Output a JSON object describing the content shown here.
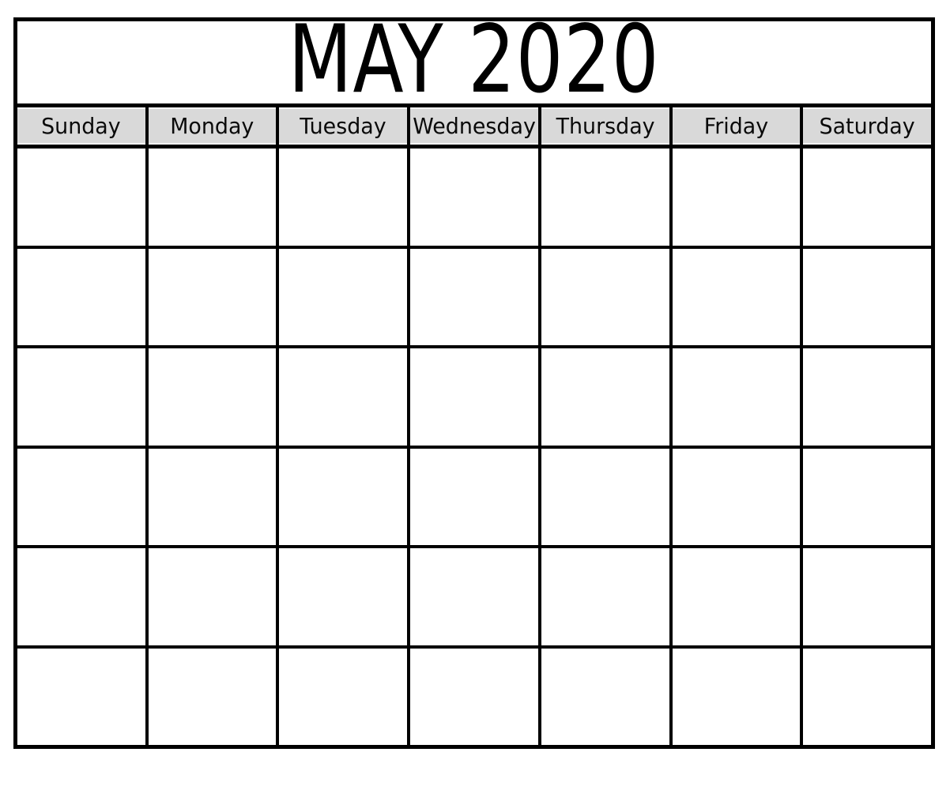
{
  "document": {
    "type": "printable-monthly-calendar",
    "title": "MAY 2020",
    "month": "MAY",
    "year": "2020",
    "week_start": "Sunday"
  },
  "colors": {
    "page_background": "#ffffff",
    "grid_border": "#000000",
    "weekday_header_fill": "#d9d9d9",
    "cell_fill": "#ffffff",
    "text": "#000000"
  },
  "weekdays": [
    {
      "label": "Sunday"
    },
    {
      "label": "Monday"
    },
    {
      "label": "Tuesday"
    },
    {
      "label": "Wednesday"
    },
    {
      "label": "Thursday"
    },
    {
      "label": "Friday"
    },
    {
      "label": "Saturday"
    }
  ],
  "weeks": [
    {
      "days": [
        {
          "number": ""
        },
        {
          "number": ""
        },
        {
          "number": ""
        },
        {
          "number": ""
        },
        {
          "number": ""
        },
        {
          "number": ""
        },
        {
          "number": ""
        }
      ]
    },
    {
      "days": [
        {
          "number": ""
        },
        {
          "number": ""
        },
        {
          "number": ""
        },
        {
          "number": ""
        },
        {
          "number": ""
        },
        {
          "number": ""
        },
        {
          "number": ""
        }
      ]
    },
    {
      "days": [
        {
          "number": ""
        },
        {
          "number": ""
        },
        {
          "number": ""
        },
        {
          "number": ""
        },
        {
          "number": ""
        },
        {
          "number": ""
        },
        {
          "number": ""
        }
      ]
    },
    {
      "days": [
        {
          "number": ""
        },
        {
          "number": ""
        },
        {
          "number": ""
        },
        {
          "number": ""
        },
        {
          "number": ""
        },
        {
          "number": ""
        },
        {
          "number": ""
        }
      ]
    },
    {
      "days": [
        {
          "number": ""
        },
        {
          "number": ""
        },
        {
          "number": ""
        },
        {
          "number": ""
        },
        {
          "number": ""
        },
        {
          "number": ""
        },
        {
          "number": ""
        }
      ]
    },
    {
      "days": [
        {
          "number": ""
        },
        {
          "number": ""
        },
        {
          "number": ""
        },
        {
          "number": ""
        },
        {
          "number": ""
        },
        {
          "number": ""
        },
        {
          "number": ""
        }
      ]
    }
  ]
}
